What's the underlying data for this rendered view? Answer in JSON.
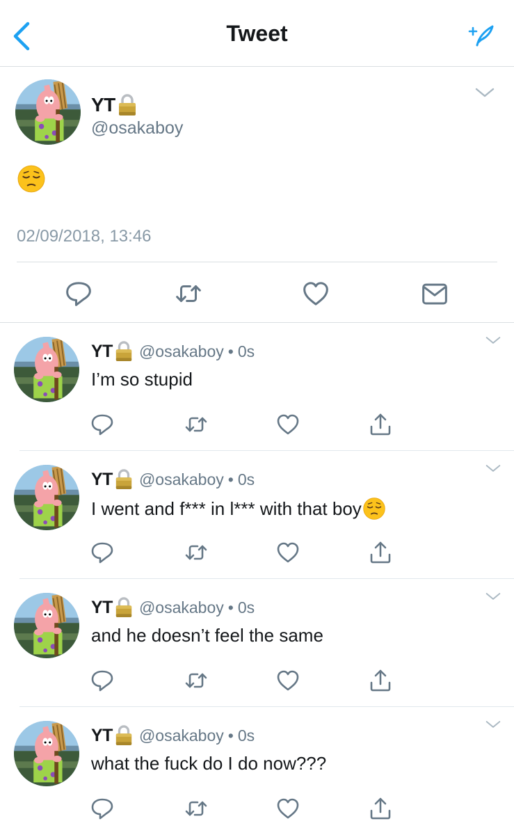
{
  "nav": {
    "title": "Tweet",
    "back_icon": "chevron-left-icon",
    "compose_icon": "compose-sparkle-icon"
  },
  "colors": {
    "accent": "#1da1f2",
    "icon_gray": "#657786",
    "text": "#14171a",
    "muted": "#8899a6",
    "border": "#d9dee2"
  },
  "main_tweet": {
    "name": "YT",
    "handle": "@osakaboy",
    "text_emoji": "pensive-face",
    "timestamp": "02/09/2018, 13:46",
    "actions": [
      "reply",
      "retweet",
      "like",
      "direct-message"
    ]
  },
  "replies": [
    {
      "name": "YT",
      "handle": "@osakaboy",
      "dot": "•",
      "time": "0s",
      "text": "I’m so stupid",
      "emoji": false
    },
    {
      "name": "YT",
      "handle": "@osakaboy",
      "dot": "•",
      "time": "0s",
      "text": "I went and f*** in l*** with that boy",
      "emoji": true
    },
    {
      "name": "YT",
      "handle": "@osakaboy",
      "dot": "•",
      "time": "0s",
      "text": "and he doesn’t feel the same",
      "emoji": false
    },
    {
      "name": "YT",
      "handle": "@osakaboy",
      "dot": "•",
      "time": "0s",
      "text": "what the fuck do I do now???",
      "emoji": false
    }
  ]
}
